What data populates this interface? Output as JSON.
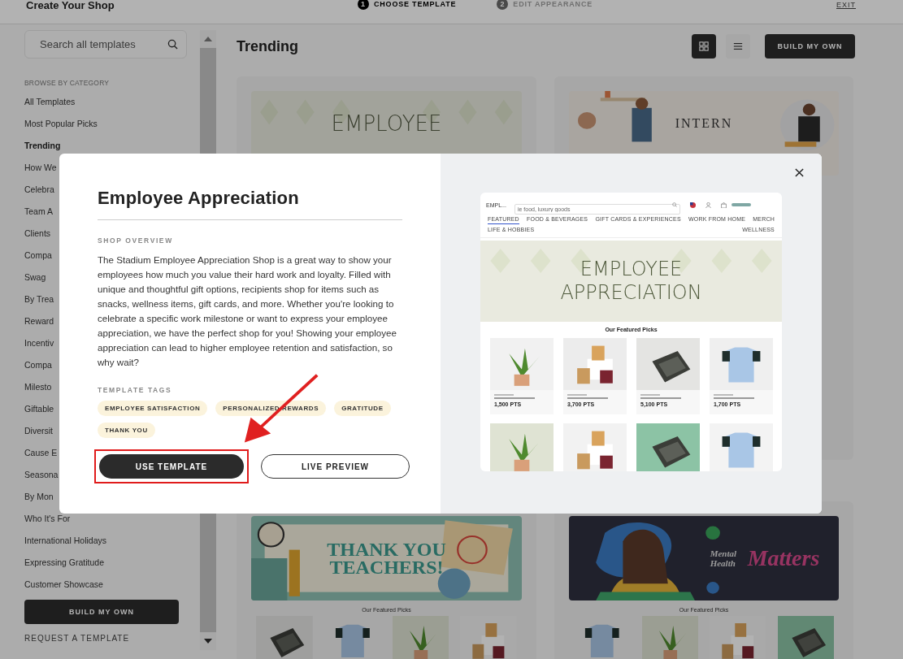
{
  "header": {
    "title": "Create Your Shop",
    "steps": [
      {
        "number": "1",
        "label": "CHOOSE TEMPLATE",
        "selected": true
      },
      {
        "number": "2",
        "label": "EDIT APPEARANCE",
        "selected": false
      }
    ],
    "exit": "EXIT"
  },
  "sidebar": {
    "search": {
      "placeholder": "Search all templates"
    },
    "heading": "BROWSE BY CATEGORY",
    "items": [
      {
        "label": "All Templates",
        "selected": false
      },
      {
        "label": "Most Popular Picks",
        "selected": false
      },
      {
        "label": "Trending",
        "selected": true
      },
      {
        "label": "How We",
        "selected": false
      },
      {
        "label": "Celebra",
        "selected": false
      },
      {
        "label": "Team A",
        "selected": false
      },
      {
        "label": "Clients",
        "selected": false
      },
      {
        "label": "Compa",
        "selected": false
      },
      {
        "label": "Swag",
        "selected": false
      },
      {
        "label": "By Trea",
        "selected": false
      },
      {
        "label": "Reward",
        "selected": false
      },
      {
        "label": "Incentiv",
        "selected": false
      },
      {
        "label": "Compa",
        "selected": false
      },
      {
        "label": "Milesto",
        "selected": false
      },
      {
        "label": "Giftable",
        "selected": false
      },
      {
        "label": "Diversit",
        "selected": false
      },
      {
        "label": "Cause E",
        "selected": false
      },
      {
        "label": "Seasona",
        "selected": false
      },
      {
        "label": "By Mon",
        "selected": false
      },
      {
        "label": "Who It's For",
        "selected": false
      },
      {
        "label": "International Holidays",
        "selected": false
      },
      {
        "label": "Expressing Gratitude",
        "selected": false
      },
      {
        "label": "Customer Showcase",
        "selected": false
      }
    ],
    "build_button": "BUILD MY OWN",
    "request_link": "REQUEST A TEMPLATE"
  },
  "main": {
    "title": "Trending",
    "views": [
      {
        "kind": "grid",
        "selected": true
      },
      {
        "kind": "list",
        "selected": false
      }
    ],
    "build_button": "BUILD MY OWN",
    "cards": [
      {
        "kind": "pattern",
        "banner_lines": [
          "EMPLOYEE"
        ]
      },
      {
        "kind": "office",
        "banner_lines": [
          "INTERN"
        ]
      },
      {
        "kind": "school",
        "banner_lines": [
          "THANK YOU",
          "TEACHERS!"
        ],
        "caption": "Our Featured Picks"
      },
      {
        "kind": "wellness",
        "banner_lines": [
          "Mental Health",
          "Matters"
        ],
        "caption": "Our Featured Picks"
      }
    ]
  },
  "modal": {
    "title": "Employee Appreciation",
    "overview_heading": "SHOP OVERVIEW",
    "overview": "The Stadium Employee Appreciation Shop is a great way to show your employees how much you value their hard work and loyalty. Filled with unique and thoughtful gift options, recipients shop for items such as snacks, wellness items, gift cards, and more. Whether you're looking to celebrate a specific work milestone or want to express your employee appreciation, we have the perfect shop for you! Showing your employee appreciation can lead to higher employee retention and satisfaction, so why wait?",
    "tags_heading": "TEMPLATE TAGS",
    "tags": [
      "EMPLOYEE SATISFACTION",
      "PERSONALIZED REWARDS",
      "GRATITUDE",
      "THANK YOU"
    ],
    "buttons": [
      {
        "kind": "primary",
        "label": "USE TEMPLATE",
        "highlighted": true
      },
      {
        "kind": "outline",
        "label": "LIVE PREVIEW",
        "highlighted": false
      }
    ],
    "preview": {
      "logo": "EMPL...",
      "search": {
        "placeholder": "ie food, luxury goods"
      },
      "nav": [
        {
          "label": "FEATURED",
          "selected": true
        },
        {
          "label": "FOOD & BEVERAGES",
          "selected": false
        },
        {
          "label": "GIFT CARDS & EXPERIENCES",
          "selected": false
        },
        {
          "label": "WORK FROM HOME",
          "selected": false
        },
        {
          "label": "MERCH",
          "selected": false
        },
        {
          "label": "LIFE & HOBBIES",
          "selected": false
        },
        {
          "label": "WELLNESS",
          "selected": false
        }
      ],
      "banner_lines": [
        "EMPLOYEE",
        "APPRECIATION"
      ],
      "section_title": "Our Featured Picks",
      "prices": [
        "1,500 PTS",
        "3,700 PTS",
        "5,100 PTS",
        "1,700 PTS"
      ]
    }
  }
}
